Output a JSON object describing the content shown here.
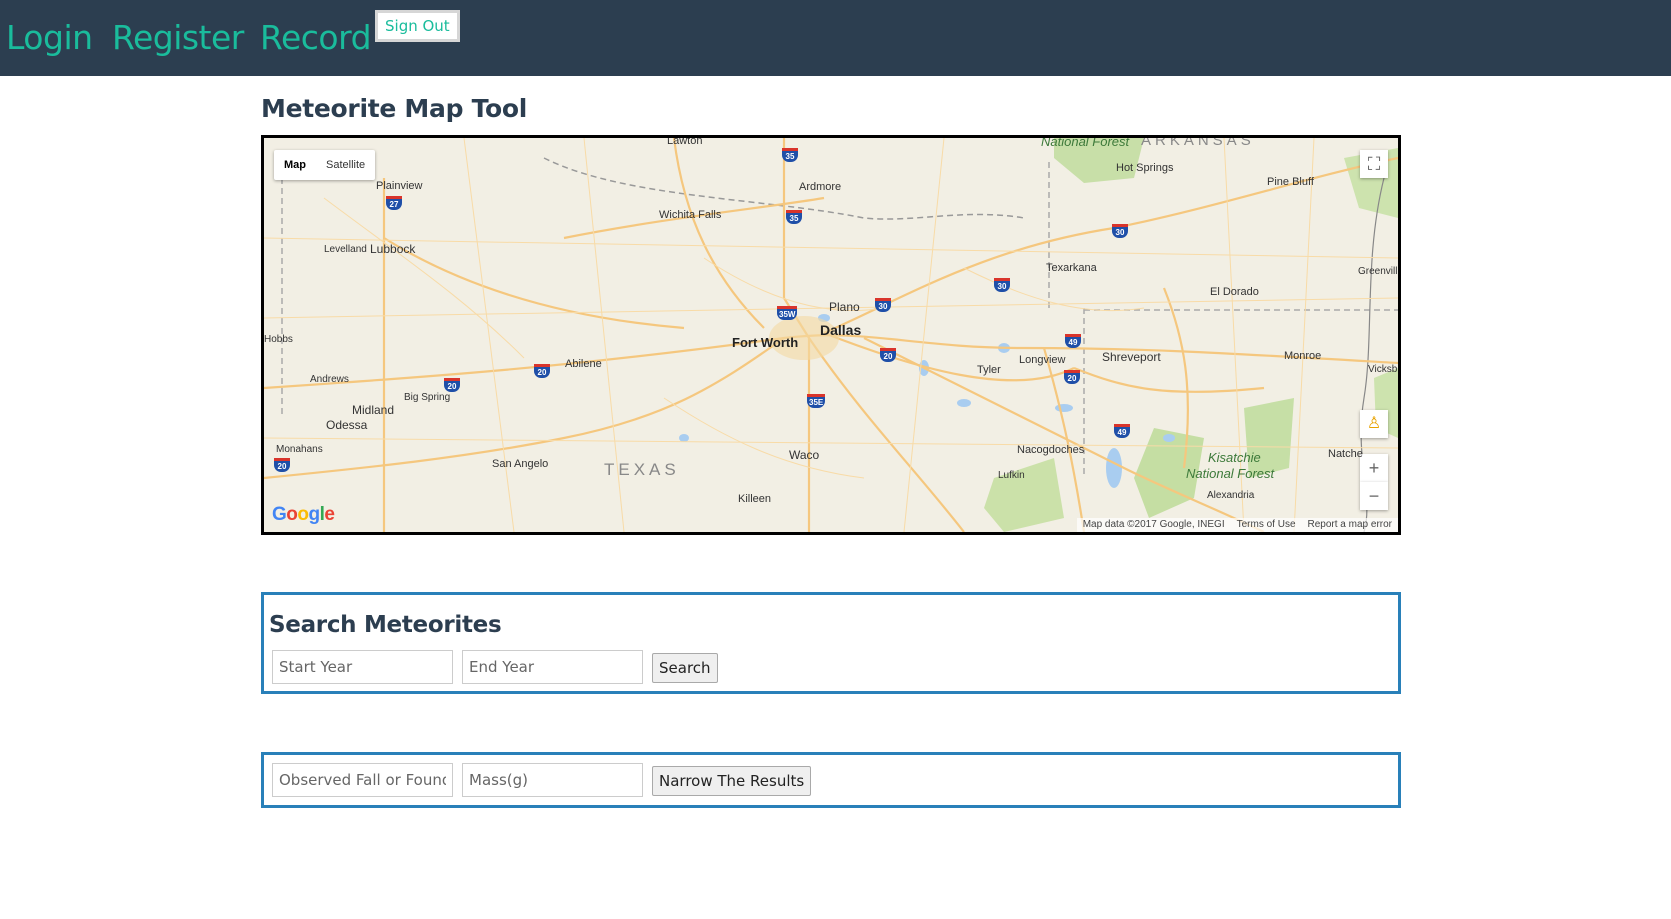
{
  "nav": {
    "login": "Login",
    "register": "Register",
    "record": "Record",
    "signout": "Sign Out"
  },
  "page": {
    "title": "Meteorite Map Tool"
  },
  "map": {
    "type_map": "Map",
    "type_satellite": "Satellite",
    "attribution": "Map data ©2017 Google, INEGI",
    "terms": "Terms of Use",
    "report": "Report a map error",
    "logo": [
      "G",
      "o",
      "o",
      "g",
      "l",
      "e"
    ],
    "labels": {
      "lawton": "Lawton",
      "national_forest_top": "National Forest",
      "arkansas": "ARKANSAS",
      "hot_springs": "Hot Springs",
      "pine_bluff": "Pine Bluff",
      "plainview": "Plainview",
      "ardmore": "Ardmore",
      "wichita_falls": "Wichita Falls",
      "levelland": "Levelland",
      "lubbock": "Lubbock",
      "texarkana": "Texarkana",
      "greenville": "Greenvill",
      "el_dorado": "El Dorado",
      "plano": "Plano",
      "hobbs": "Hobbs",
      "fort_worth": "Fort Worth",
      "dallas": "Dallas",
      "longview": "Longview",
      "shreveport": "Shreveport",
      "monroe": "Monroe",
      "vicksburg": "Vicksb",
      "abilene": "Abilene",
      "tyler": "Tyler",
      "andrews": "Andrews",
      "big_spring": "Big Spring",
      "midland": "Midland",
      "odessa": "Odessa",
      "monahans": "Monahans",
      "nacogdoches": "Nacogdoches",
      "kisatchie": "Kisatchie",
      "national_forest_bottom": "National Forest",
      "natchez": "Natche",
      "san_angelo": "San Angelo",
      "texas": "TEXAS",
      "waco": "Waco",
      "lufkin": "Lufkin",
      "killeen": "Killeen",
      "alexandria": "Alexandria"
    },
    "shields": [
      "35",
      "27",
      "35",
      "30",
      "30",
      "35W",
      "30",
      "49",
      "20",
      "20",
      "20",
      "20",
      "35E",
      "49",
      "20"
    ]
  },
  "search": {
    "title": "Search Meteorites",
    "start_placeholder": "Start Year",
    "end_placeholder": "End Year",
    "button": "Search"
  },
  "narrow": {
    "fall_placeholder": "Observed Fall or Found",
    "mass_placeholder": "Mass(g)",
    "button": "Narrow The Results"
  },
  "colors": {
    "topbar": "#2c3e50",
    "accent": "#1abc9c",
    "panel_border": "#2980b9"
  }
}
